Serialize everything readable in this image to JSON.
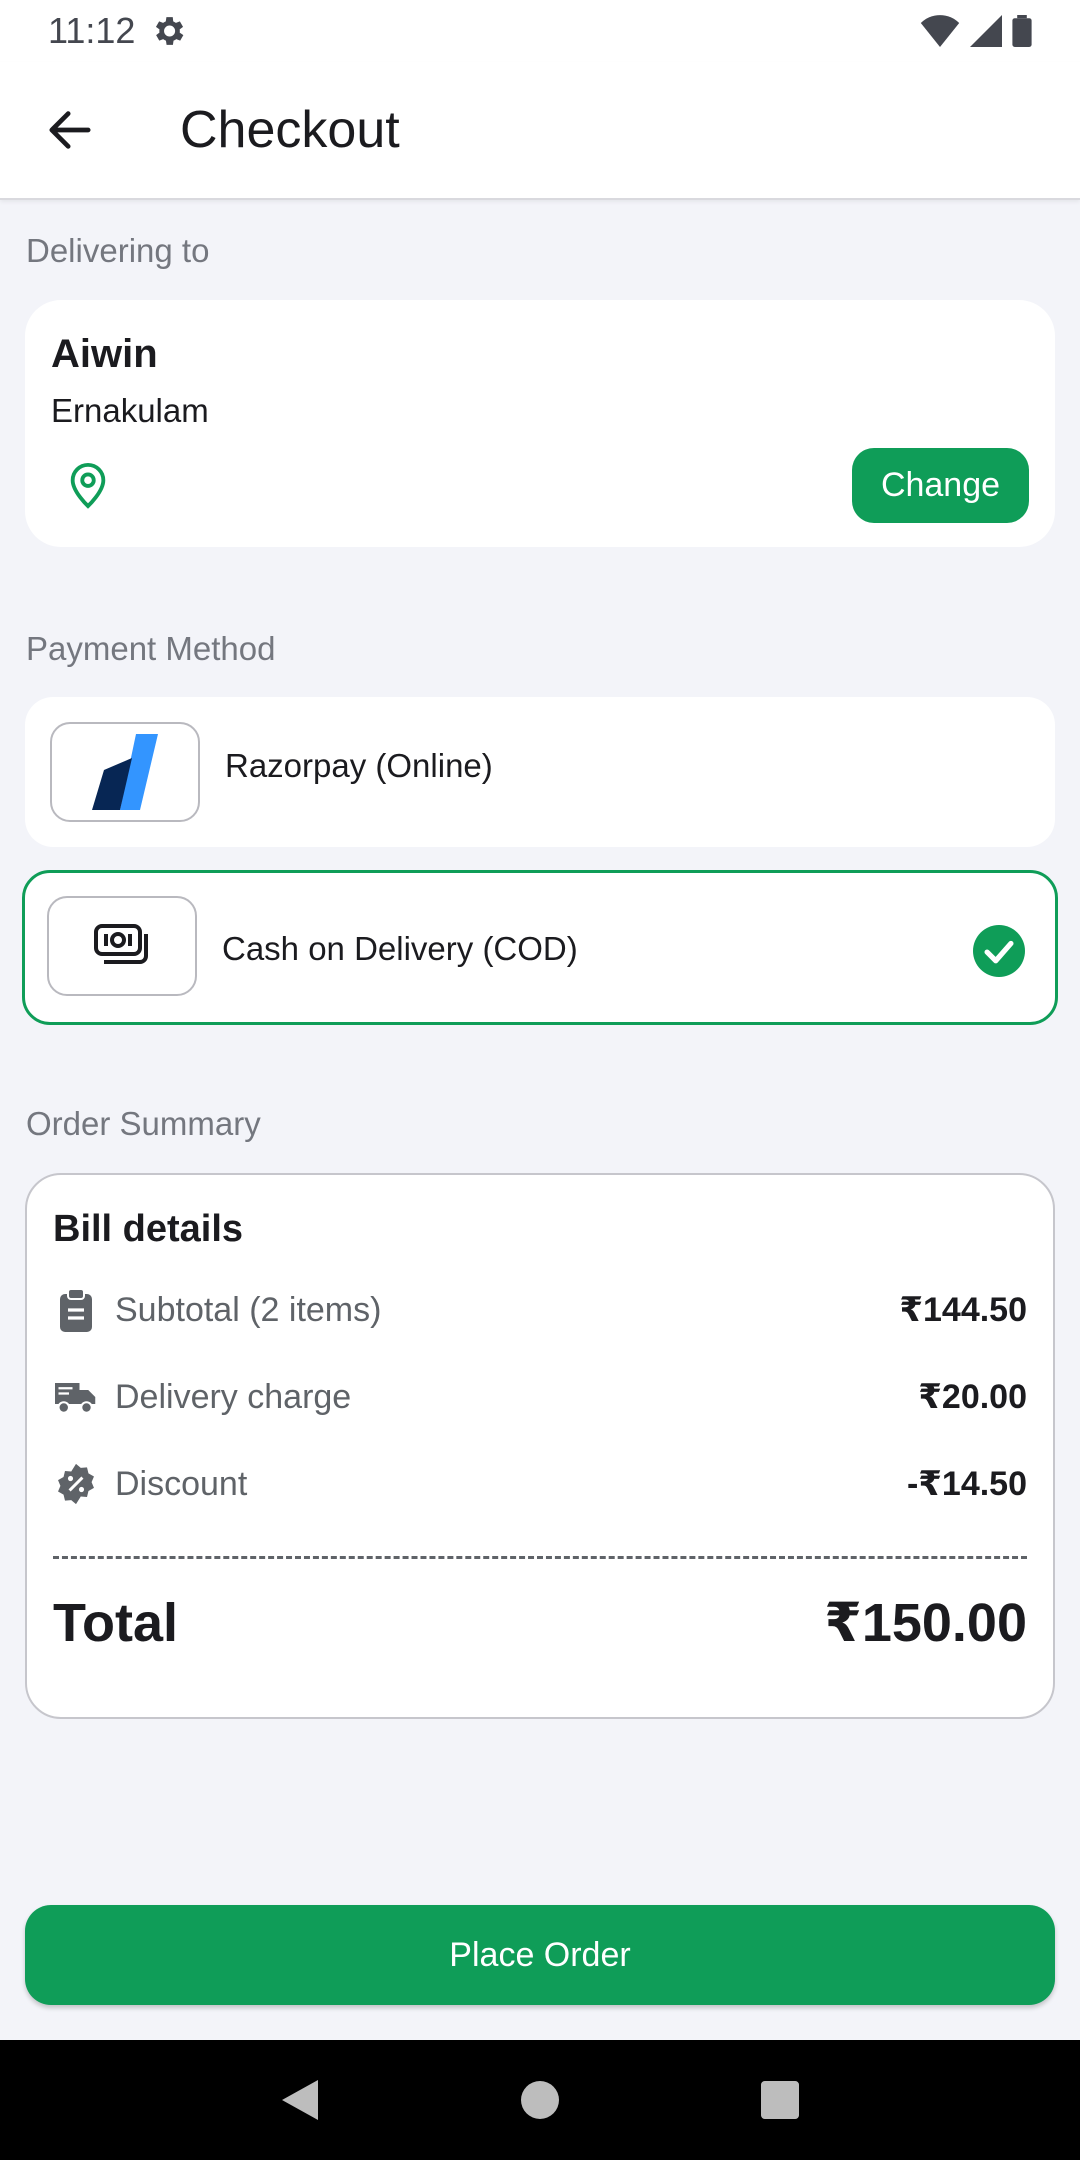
{
  "status_bar": {
    "time": "11:12"
  },
  "app_bar": {
    "title": "Checkout"
  },
  "delivery": {
    "section_label": "Delivering to",
    "name": "Aiwin",
    "city": "Ernakulam",
    "change_label": "Change"
  },
  "payment": {
    "section_label": "Payment Method",
    "options": [
      {
        "label": "Razorpay (Online)",
        "icon": "razorpay-logo",
        "selected": false
      },
      {
        "label": "Cash on Delivery (COD)",
        "icon": "cash-icon",
        "selected": true
      }
    ]
  },
  "summary": {
    "section_label": "Order Summary",
    "bill_title": "Bill details",
    "rows": [
      {
        "label": "Subtotal (2 items)",
        "value": "₹144.50",
        "icon": "clipboard-icon"
      },
      {
        "label": "Delivery charge",
        "value": "₹20.00",
        "icon": "delivery-truck-icon"
      },
      {
        "label": "Discount",
        "value": "-₹14.50",
        "icon": "discount-badge-icon"
      }
    ],
    "total_label": "Total",
    "total_value": "₹150.00"
  },
  "place_order_label": "Place Order",
  "colors": {
    "accent": "#0f9d58",
    "background": "#f3f4f9",
    "card": "#ffffff",
    "muted_text": "#74777f"
  }
}
